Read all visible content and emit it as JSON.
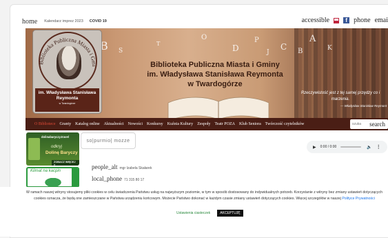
{
  "topbar": {
    "home": "home",
    "calendar": "Kalendarz imprez 2023",
    "covid": "COVID 19",
    "accessible": "accessible",
    "phone": "phone",
    "email": "emai"
  },
  "hero": {
    "title_line1": "Biblioteka Publiczna Miasta i Gminy",
    "title_line2": "im. Władysława Stanisława Reymonta",
    "title_line3": "w Twardogórze",
    "quote": "Rzeczywistość jest z tej samej przędzy co i marzenia.",
    "quote_author": "— Władysław Stanisław Reymont"
  },
  "logo": {
    "ring_text": "Biblioteka Publiczna Miasta i Gminy",
    "plaque_line1": "im. Władysława Stanisława",
    "plaque_line2": "Reymonta",
    "plaque_line3": "w Twardogórze"
  },
  "nav": {
    "items": [
      "O Bibliotece",
      "Granty",
      "Katalog online",
      "Aktualności",
      "Nowości",
      "Konkursy",
      "Kuźnia Kultury",
      "Zespoły",
      "Teatr POZA",
      "Klub Seniora",
      "Twórczość czytelników"
    ],
    "search_placeholder": "szuka",
    "search_label": "search"
  },
  "sidebar": {
    "banner1_top": "dolinabaryczy.travel",
    "banner1_mid": "odkryj",
    "banner1_name": "Dolinę Baryczy",
    "banner1_button": "ZOBACZ WIĘCEJ >",
    "banner2_text": "Klimat na kacpin"
  },
  "brand_box": "so|purmio| mozze",
  "audio": {
    "time": "0:00 / 0:00"
  },
  "contacts": [
    {
      "icon": "people_alt",
      "text": "mgr Izabela Skałarek"
    },
    {
      "icon": "local_phone",
      "text": "71 315 80 17"
    }
  ],
  "cookie": {
    "message": "W ramach naszej witryny stosujemy pliki cookies w celu świadczenia Państwu usług na najwyższym poziomie, w tym w sposób dostosowany do indywidualnych potrzeb. Korzystanie z witryny bez zmiany ustawień dotyczących cookies oznacza, że będą one zamieszczane w Państwa urządzeniu końcowym. Możecie Państwo dokonać w każdym czasie zmiany ustawień dotyczących cookies. Więcej szczegółów w naszej",
    "policy_link": "Polityce Prywatności",
    "settings": "Ustawienia ciasteczek",
    "accept": "AKCEPTUJĘ"
  },
  "colors": {
    "nav_bg": "#4a1e15",
    "nav_active": "#e04a36",
    "accept_bg": "#111111",
    "settings_link": "#2b8a3e"
  }
}
